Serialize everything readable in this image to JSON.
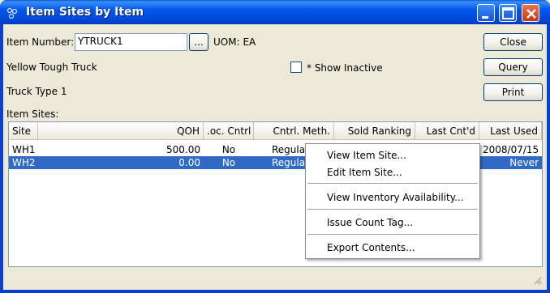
{
  "window": {
    "title": "Item Sites by Item",
    "buttons": [
      "minimize",
      "maximize",
      "close"
    ]
  },
  "form": {
    "item_number_label": "Item Number:",
    "item_number_value": "YTRUCK1",
    "lookup_button": "...",
    "uom_label": "UOM: EA",
    "description1": "Yellow Tough Truck",
    "description2": "Truck Type 1",
    "show_inactive_label": "* Show Inactive",
    "show_inactive_checked": false,
    "item_sites_label": "Item Sites:"
  },
  "actions": {
    "close": "Close",
    "query": "Query",
    "print": "Print"
  },
  "table": {
    "columns": [
      "Site",
      "QOH",
      ".oc. Cntrl",
      "Cntrl. Meth.",
      "Sold Ranking",
      "Last Cnt'd",
      "Last Used"
    ],
    "rows": [
      {
        "site": "WH1",
        "qoh": "500.00",
        "loc_cntrl": "No",
        "cntrl_meth": "Regular",
        "sold_ranking": "",
        "last_cntd": "",
        "last_used": "2008/07/15",
        "selected": false
      },
      {
        "site": "WH2",
        "qoh": "0.00",
        "loc_cntrl": "No",
        "cntrl_meth": "Regular",
        "sold_ranking": "",
        "last_cntd": "",
        "last_used": "Never",
        "selected": true
      }
    ]
  },
  "context_menu": {
    "items": [
      "View Item Site...",
      "Edit Item Site...",
      "View Inventory Availability...",
      "Issue Count Tag...",
      "Export Contents..."
    ]
  },
  "colors": {
    "titlebar": "#0058ee",
    "selection": "#316ac5",
    "dialog_bg": "#ece9d8"
  }
}
